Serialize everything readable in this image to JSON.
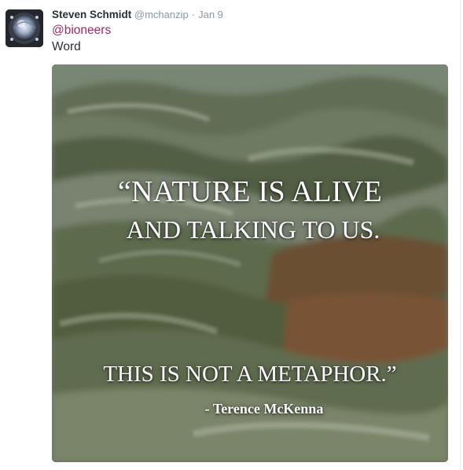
{
  "tweet": {
    "author_name": "Steven Schmidt",
    "author_handle": "@mchanzip",
    "separator": "·",
    "timestamp": "Jan 9",
    "mention": "@bioneers",
    "text": "Word"
  },
  "media": {
    "quote_line_1": "“NATURE IS ALIVE",
    "quote_line_2": "AND TALKING TO US.",
    "quote_line_3": "THIS IS NOT A METAPHOR.”",
    "attribution": "- Terence McKenna"
  },
  "colors": {
    "mention": "#9e2a64",
    "muted": "#8899a6",
    "text": "#292f33"
  }
}
